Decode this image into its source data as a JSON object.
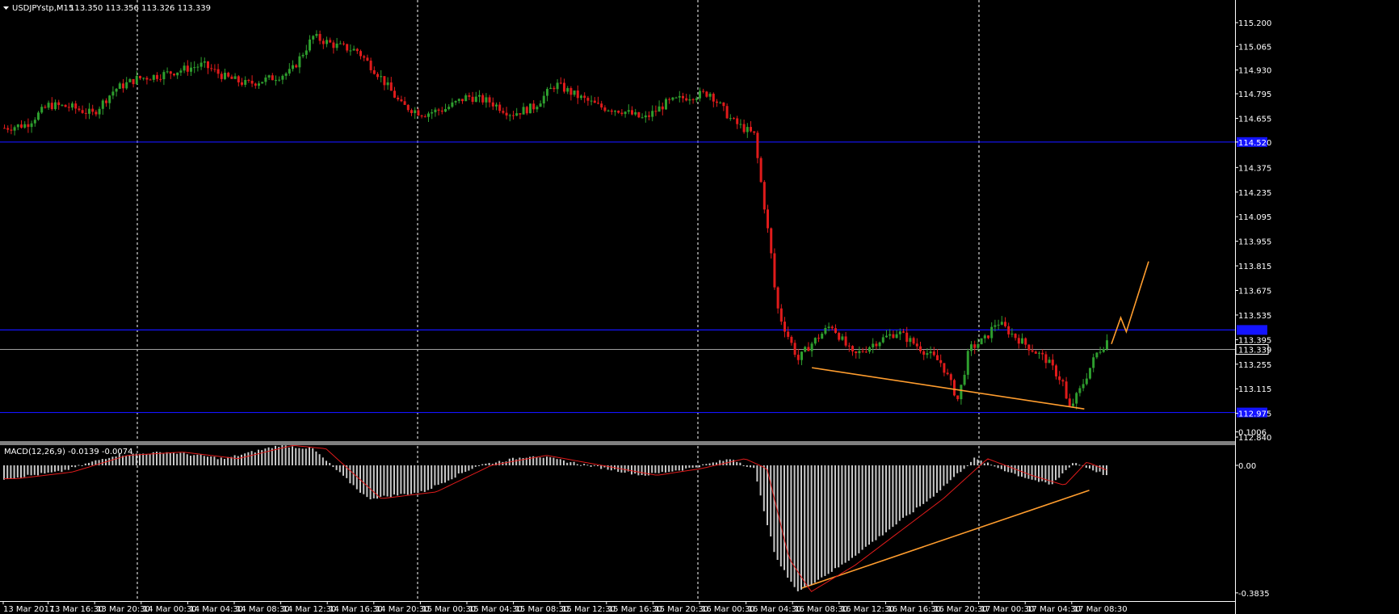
{
  "header": {
    "symbol": "USDJPYstp,M15",
    "ohlc": "113.350 113.356 113.326 113.339"
  },
  "macd_header": {
    "title": "MACD(12,26,9) -0.0139 -0.0074"
  },
  "colors": {
    "background": "#000000",
    "bull_candle": "#2e9e2e",
    "bear_candle": "#e01b1b",
    "hline": "#1414ff",
    "trendline": "#ff9d2e",
    "histogram": "#c8c8c8",
    "signal": "#e01b1b",
    "grid": "#ffffff"
  },
  "chart_data": [
    {
      "type": "candlestick",
      "title": "USDJPYstp,M15",
      "y_ticks": [
        "115.200",
        "115.065",
        "114.930",
        "114.795",
        "114.655",
        "114.520",
        "114.375",
        "114.235",
        "114.095",
        "113.955",
        "113.815",
        "113.675",
        "113.535",
        "113.395",
        "113.255",
        "113.115",
        "112.975",
        "112.840"
      ],
      "ylim": [
        112.82,
        115.26
      ],
      "current_price": "113.339",
      "horizontal_lines": [
        114.52,
        113.45,
        112.98
      ],
      "x_tick_labels": [
        "13 Mar 2017",
        "13 Mar 16:30",
        "13 Mar 20:30",
        "14 Mar 00:30",
        "14 Mar 04:30",
        "14 Mar 08:30",
        "14 Mar 12:30",
        "14 Mar 16:30",
        "14 Mar 20:30",
        "15 Mar 00:30",
        "15 Mar 04:30",
        "15 Mar 08:30",
        "15 Mar 12:30",
        "15 Mar 16:30",
        "15 Mar 20:30",
        "16 Mar 00:30",
        "16 Mar 04:30",
        "16 Mar 08:30",
        "16 Mar 12:30",
        "16 Mar 16:30",
        "16 Mar 20:30",
        "17 Mar 00:30",
        "17 Mar 04:30",
        "17 Mar 08:30"
      ],
      "close_path": [
        [
          0,
          114.6
        ],
        [
          0.02,
          114.62
        ],
        [
          0.04,
          114.73
        ],
        [
          0.06,
          114.72
        ],
        [
          0.08,
          114.68
        ],
        [
          0.1,
          114.82
        ],
        [
          0.12,
          114.88
        ],
        [
          0.14,
          114.9
        ],
        [
          0.16,
          114.93
        ],
        [
          0.18,
          114.96
        ],
        [
          0.2,
          114.89
        ],
        [
          0.22,
          114.85
        ],
        [
          0.24,
          114.88
        ],
        [
          0.26,
          114.92
        ],
        [
          0.28,
          115.12
        ],
        [
          0.3,
          115.07
        ],
        [
          0.32,
          115.04
        ],
        [
          0.34,
          114.9
        ],
        [
          0.36,
          114.73
        ],
        [
          0.38,
          114.68
        ],
        [
          0.4,
          114.71
        ],
        [
          0.42,
          114.78
        ],
        [
          0.44,
          114.75
        ],
        [
          0.46,
          114.68
        ],
        [
          0.48,
          114.72
        ],
        [
          0.5,
          114.85
        ],
        [
          0.52,
          114.78
        ],
        [
          0.54,
          114.72
        ],
        [
          0.56,
          114.7
        ],
        [
          0.58,
          114.65
        ],
        [
          0.6,
          114.74
        ],
        [
          0.62,
          114.78
        ],
        [
          0.64,
          114.8
        ],
        [
          0.66,
          114.64
        ],
        [
          0.68,
          114.56
        ],
        [
          0.695,
          113.9
        ],
        [
          0.7,
          113.6
        ],
        [
          0.705,
          113.5
        ],
        [
          0.72,
          113.28
        ],
        [
          0.73,
          113.36
        ],
        [
          0.75,
          113.48
        ],
        [
          0.77,
          113.3
        ],
        [
          0.79,
          113.38
        ],
        [
          0.81,
          113.44
        ],
        [
          0.83,
          113.35
        ],
        [
          0.85,
          113.26
        ],
        [
          0.865,
          113.05
        ],
        [
          0.875,
          113.34
        ],
        [
          0.89,
          113.4
        ],
        [
          0.9,
          113.5
        ],
        [
          0.915,
          113.42
        ],
        [
          0.93,
          113.35
        ],
        [
          0.945,
          113.28
        ],
        [
          0.96,
          113.15
        ],
        [
          0.965,
          112.99
        ],
        [
          0.975,
          113.1
        ],
        [
          0.99,
          113.31
        ],
        [
          1.0,
          113.39
        ]
      ],
      "trendlines": [
        {
          "from": [
            113.235,
            0.7297
          ],
          "to": [
            113.0,
            0.9755
          ]
        }
      ],
      "projection": [
        [
          113.37,
          0
        ],
        [
          113.52,
          0.25
        ],
        [
          113.44,
          0.4
        ],
        [
          113.84,
          1
        ]
      ]
    },
    {
      "type": "histogram",
      "title": "MACD(12,26,9)",
      "y_ticks": [
        "0.1006",
        "0.00",
        "-0.3835"
      ],
      "ylim": [
        -0.4,
        0.115
      ],
      "values_path": [
        [
          0,
          -0.04
        ],
        [
          0.05,
          -0.02
        ],
        [
          0.1,
          0.03
        ],
        [
          0.15,
          0.04
        ],
        [
          0.2,
          0.02
        ],
        [
          0.25,
          0.06
        ],
        [
          0.28,
          0.05
        ],
        [
          0.33,
          -0.1
        ],
        [
          0.38,
          -0.08
        ],
        [
          0.43,
          0.0
        ],
        [
          0.48,
          0.03
        ],
        [
          0.53,
          0.0
        ],
        [
          0.58,
          -0.03
        ],
        [
          0.62,
          -0.01
        ],
        [
          0.66,
          0.02
        ],
        [
          0.68,
          -0.01
        ],
        [
          0.7,
          -0.28
        ],
        [
          0.72,
          -0.38
        ],
        [
          0.76,
          -0.3
        ],
        [
          0.8,
          -0.2
        ],
        [
          0.84,
          -0.1
        ],
        [
          0.88,
          0.02
        ],
        [
          0.92,
          -0.03
        ],
        [
          0.95,
          -0.06
        ],
        [
          0.97,
          0.01
        ],
        [
          1.0,
          -0.03
        ]
      ],
      "trendlines": [
        {
          "from": [
            -0.37,
            0.72
          ],
          "to": [
            -0.075,
            0.98
          ]
        }
      ]
    }
  ]
}
